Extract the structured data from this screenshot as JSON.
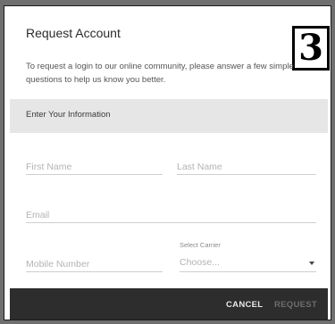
{
  "dialog": {
    "title": "Request Account",
    "step_number": "3",
    "intro": "To request a login to our online community, please answer a few simple questions to help us know you better."
  },
  "section": {
    "label": "Enter Your Information"
  },
  "form": {
    "first_name": {
      "value": "",
      "placeholder": "First Name"
    },
    "last_name": {
      "value": "",
      "placeholder": "Last Name"
    },
    "email": {
      "value": "",
      "placeholder": "Email"
    },
    "mobile": {
      "value": "",
      "placeholder": "Mobile Number"
    },
    "carrier": {
      "label": "Select Carrier",
      "value": "Choose..."
    }
  },
  "footer": {
    "cancel_label": "CANCEL",
    "request_label": "REQUEST"
  },
  "icons": {
    "carrier_dropdown": "chevron-down-icon"
  },
  "colors": {
    "overlay": "#6f6f6f",
    "section_bg": "#e6e6e6",
    "footer_bg": "#2d2d2d",
    "cancel_text": "#e8e8e8",
    "request_text_disabled": "#6d6d6d"
  }
}
